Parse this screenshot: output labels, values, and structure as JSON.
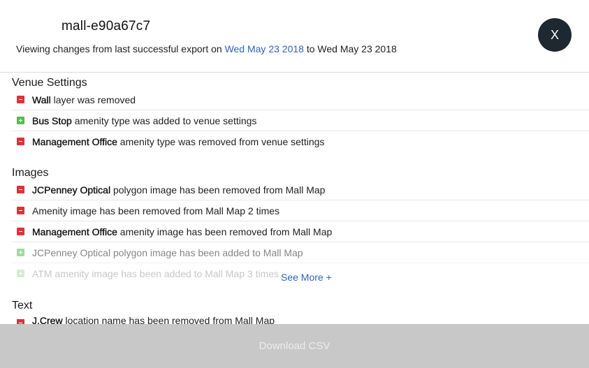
{
  "header": {
    "title": "mall-e90a67c7",
    "subtitle_prefix": "Viewing changes from last successful export on ",
    "from_date": "Wed May 23 2018",
    "subtitle_middle": " to ",
    "to_date": "Wed May 23 2018",
    "close_label": "X"
  },
  "sections": {
    "venue_settings": {
      "title": "Venue Settings",
      "rows": [
        {
          "status": "removed",
          "subject": "Wall",
          "text": " layer was removed"
        },
        {
          "status": "added",
          "subject": "Bus Stop",
          "text": " amenity type was added to venue settings"
        },
        {
          "status": "removed",
          "subject": "Management Office",
          "text": " amenity type was removed from venue settings"
        }
      ]
    },
    "images": {
      "title": "Images",
      "rows": [
        {
          "status": "removed",
          "subject": "JCPenney Optical",
          "text": " polygon image has been removed from Mall Map"
        },
        {
          "status": "removed",
          "subject": "",
          "text": "Amenity image has been removed from Mall Map 2 times"
        },
        {
          "status": "removed",
          "subject": "Management Office",
          "text": " amenity image has been removed from Mall Map"
        },
        {
          "status": "added",
          "subject": "",
          "text": "JCPenney Optical polygon image has been added to Mall Map"
        },
        {
          "status": "added",
          "subject": "",
          "text": "ATM amenity image has been added to Mall Map 3 times"
        }
      ],
      "see_more_label": "See More +"
    },
    "text": {
      "title": "Text",
      "rows": [
        {
          "status": "removed",
          "subject": "J.Crew",
          "text": " location name has been removed from Mall Map"
        }
      ]
    }
  },
  "footer": {
    "download_label": "Download CSV"
  },
  "colors": {
    "removed": "#d9343a",
    "added": "#58bb4f",
    "link": "#2f64b4",
    "close_bg": "#1d2830",
    "footer_bg": "#c8c8c8"
  }
}
